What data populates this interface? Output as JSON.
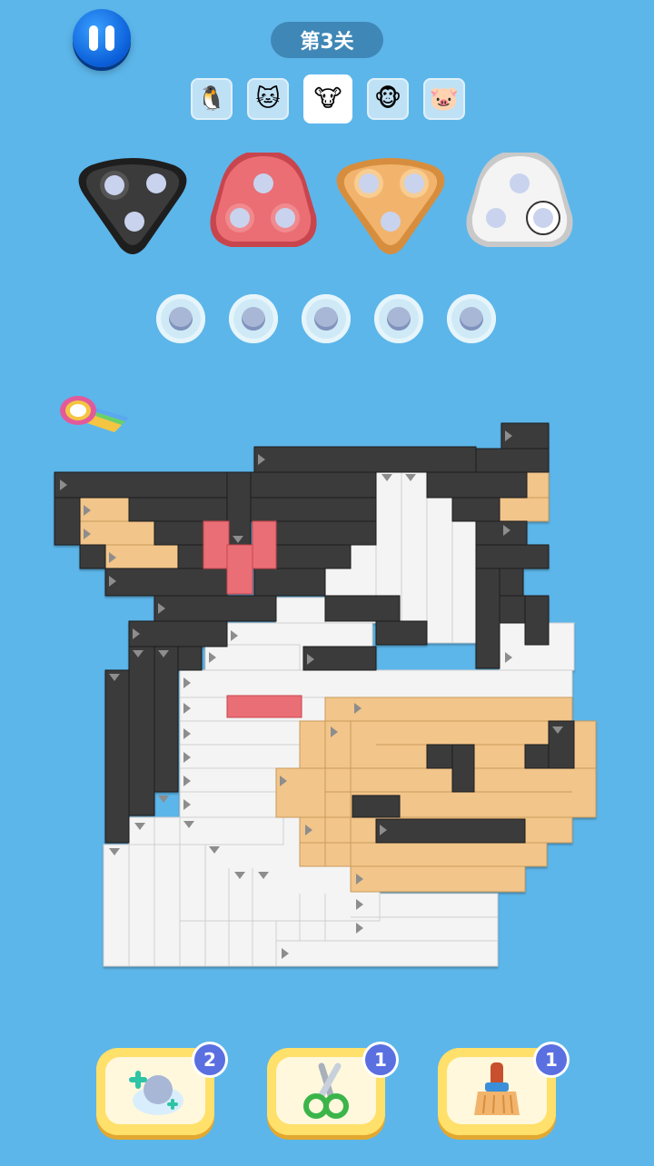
{
  "header": {
    "level_label": "第3关"
  },
  "pictures": [
    {
      "name": "penguin",
      "glyph": "🐧"
    },
    {
      "name": "cat",
      "glyph": "🐱"
    },
    {
      "name": "cow",
      "glyph": "🐮"
    },
    {
      "name": "monkey",
      "glyph": "🐵"
    },
    {
      "name": "pig",
      "glyph": "🐷"
    }
  ],
  "spools": [
    {
      "color": "#3b3b3b",
      "pegs": [
        "plain",
        "plain",
        "plain"
      ]
    },
    {
      "color": "#e96e72",
      "pegs": [
        "plain",
        "plain",
        "plain"
      ]
    },
    {
      "color": "#f2b46c",
      "pegs": [
        "plain",
        "plain",
        "plain"
      ]
    },
    {
      "color": "#f4f4f4",
      "pegs": [
        "plain",
        "plain",
        "filled"
      ]
    }
  ],
  "slots_count": 5,
  "powerups": [
    {
      "name": "add-slot",
      "count": "2"
    },
    {
      "name": "scissors",
      "count": "1"
    },
    {
      "name": "brush",
      "count": "1"
    }
  ],
  "colors": {
    "black": "#3b3b3b",
    "white": "#f4f4f4",
    "tan": "#f2c58a",
    "pink": "#ea6e74"
  }
}
